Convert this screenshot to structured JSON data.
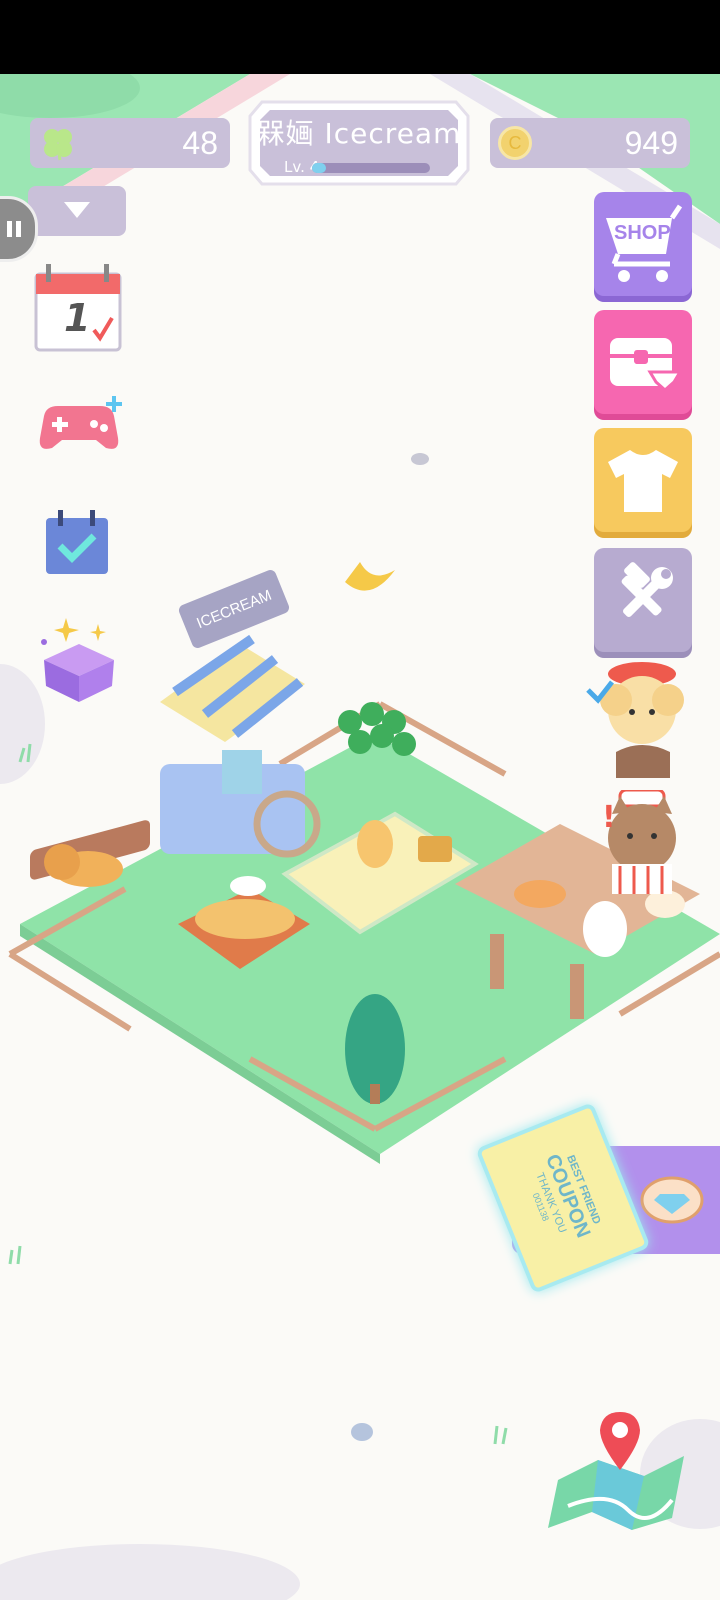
{
  "status_bar": {},
  "header": {
    "clover_count": "48",
    "shop_name": "槑婳 Icecream",
    "level": "Lv. 4",
    "level_progress": 0.12,
    "coin_count": "949",
    "coin_symbol": "C"
  },
  "side_buttons": {
    "shop_label": "SHOP",
    "calendar_day": "1"
  },
  "scene": {
    "cart_sign": "ICECREAM",
    "coupon_line1": "BEST FRIEND",
    "coupon_line2": "COUPON",
    "coupon_line3": "THANK YOU",
    "coupon_serial": "001138"
  },
  "colors": {
    "shop_purple": "#a684ea",
    "chest_pink": "#f667b0",
    "shirt_yellow": "#f7c95e",
    "tools_lavender": "#b7abd0",
    "grass": "#8fe3a8",
    "panel": "#c9c0d9"
  }
}
